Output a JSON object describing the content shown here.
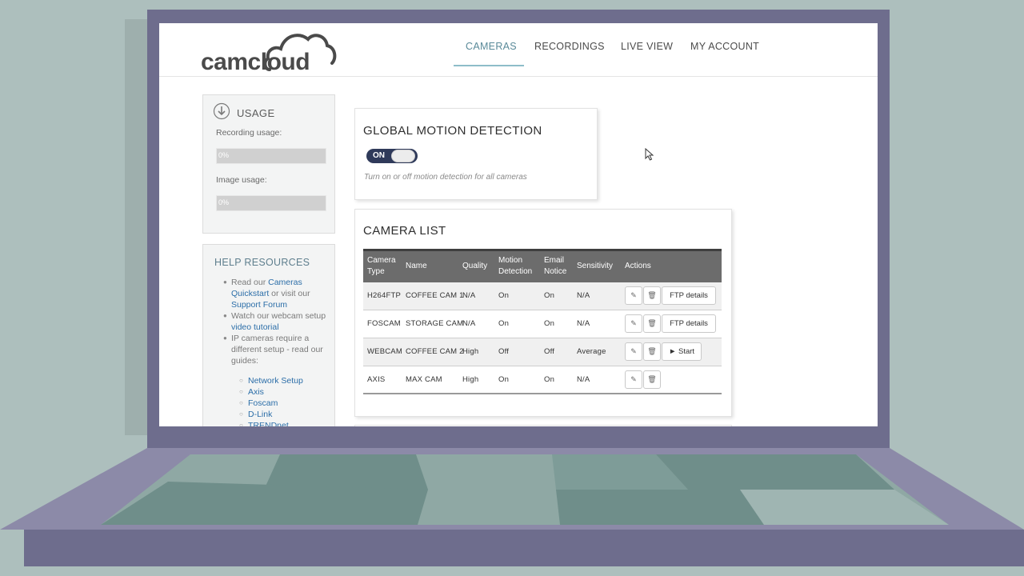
{
  "header": {
    "logo_text": "camcloud",
    "nav": [
      {
        "label": "CAMERAS",
        "active": true
      },
      {
        "label": "RECORDINGS",
        "active": false
      },
      {
        "label": "LIVE VIEW",
        "active": false
      },
      {
        "label": "MY ACCOUNT",
        "active": false
      }
    ]
  },
  "sidebar": {
    "usage": {
      "title": "USAGE",
      "recording_label": "Recording usage:",
      "recording_value": "0%",
      "recording_fraction": 0,
      "image_label": "Image usage:",
      "image_value": "0%",
      "image_fraction": 0
    },
    "help": {
      "title": "HELP RESOURCES",
      "item1_pre": "Read our ",
      "item1_link1": "Cameras Quickstart",
      "item1_mid": " or visit our ",
      "item1_link2": "Support Forum",
      "item2_pre": "Watch our webcam setup ",
      "item2_link": "video tutorial",
      "item3": "IP cameras require a different setup - read our guides:",
      "guides": [
        "Network Setup",
        "Axis",
        "Foscam",
        "D-Link",
        "TRENDnet"
      ]
    }
  },
  "motion": {
    "title": "GLOBAL MOTION DETECTION",
    "toggle_label": "ON",
    "toggle_on": true,
    "hint": "Turn on or off motion detection for all cameras"
  },
  "camera_list": {
    "title": "CAMERA LIST",
    "columns": [
      "Camera Type",
      "Name",
      "Quality",
      "Motion Detection",
      "Email Notice",
      "Sensitivity",
      "Actions"
    ],
    "rows": [
      {
        "type": "H264FTP",
        "name": "COFFEE CAM 1",
        "quality": "N/A",
        "motion": "On",
        "email": "On",
        "sensitivity": "N/A",
        "action": "FTP details"
      },
      {
        "type": "FOSCAM",
        "name": "STORAGE CAM",
        "quality": "N/A",
        "motion": "On",
        "email": "On",
        "sensitivity": "N/A",
        "action": "FTP details"
      },
      {
        "type": "WEBCAM",
        "name": "COFFEE CAM 2",
        "quality": "High",
        "motion": "Off",
        "email": "Off",
        "sensitivity": "Average",
        "action": "► Start"
      },
      {
        "type": "AXIS",
        "name": "MAX CAM",
        "quality": "High",
        "motion": "On",
        "email": "On",
        "sensitivity": "N/A",
        "action": ""
      }
    ],
    "edit_icon": "pencil-icon",
    "delete_icon": "trash-icon"
  },
  "colors": {
    "laptop_frame": "#6e6d8d",
    "table_header": "#6c6c6c",
    "toggle_bg": "#2f3a5a",
    "link": "#2c6ea8",
    "nav_active": "#5a8a99"
  }
}
